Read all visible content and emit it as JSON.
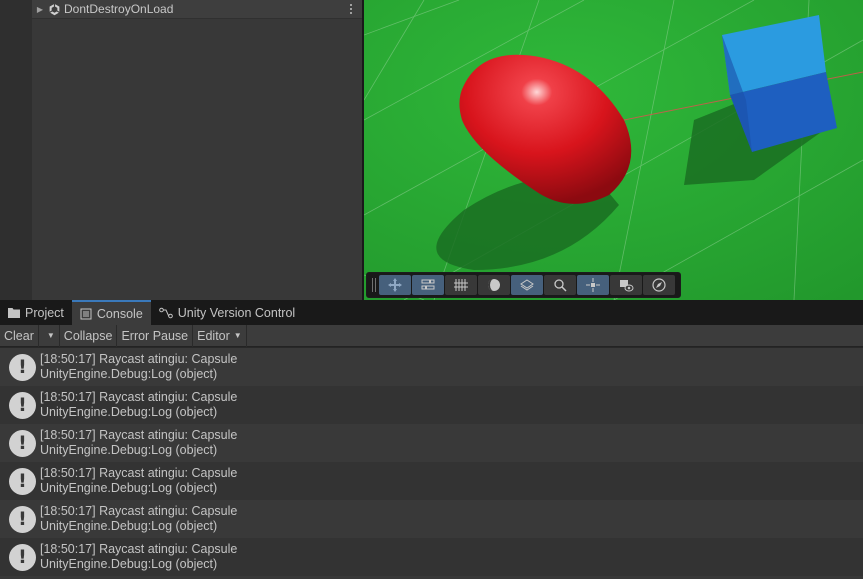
{
  "hierarchy": {
    "items": [
      {
        "label": "DontDestroyOnLoad",
        "expanded": false
      }
    ]
  },
  "scene_toolbar": {
    "tools": [
      {
        "name": "move-view-icon",
        "active": true
      },
      {
        "name": "toggle-panels-icon",
        "active": true
      },
      {
        "name": "grid-icon",
        "active": false
      },
      {
        "name": "shading-icon",
        "active": false
      },
      {
        "name": "surface-snapping-icon",
        "active": true
      },
      {
        "name": "search-icon",
        "active": false
      },
      {
        "name": "center-pivot-icon",
        "active": true
      },
      {
        "name": "visibility-icon",
        "active": false
      },
      {
        "name": "compass-icon",
        "active": false
      }
    ]
  },
  "tabs": [
    {
      "label": "Project",
      "icon": "folder-icon",
      "active": false
    },
    {
      "label": "Console",
      "icon": "console-icon",
      "active": true
    },
    {
      "label": "Unity Version Control",
      "icon": "branch-icon",
      "active": false
    }
  ],
  "console_toolbar": {
    "clear": "Clear",
    "collapse": "Collapse",
    "error_pause": "Error Pause",
    "editor": "Editor"
  },
  "console_logs": [
    {
      "line1": "[18:50:17] Raycast atingiu: Capsule",
      "line2": "UnityEngine.Debug:Log (object)"
    },
    {
      "line1": "[18:50:17] Raycast atingiu: Capsule",
      "line2": "UnityEngine.Debug:Log (object)"
    },
    {
      "line1": "[18:50:17] Raycast atingiu: Capsule",
      "line2": "UnityEngine.Debug:Log (object)"
    },
    {
      "line1": "[18:50:17] Raycast atingiu: Capsule",
      "line2": "UnityEngine.Debug:Log (object)"
    },
    {
      "line1": "[18:50:17] Raycast atingiu: Capsule",
      "line2": "UnityEngine.Debug:Log (object)"
    },
    {
      "line1": "[18:50:17] Raycast atingiu: Capsule",
      "line2": "UnityEngine.Debug:Log (object)"
    }
  ],
  "colors": {
    "ground": "#28a832",
    "capsule": "#d8141c",
    "cube": "#1e6cc8",
    "active_tab_accent": "#3a79bb"
  }
}
